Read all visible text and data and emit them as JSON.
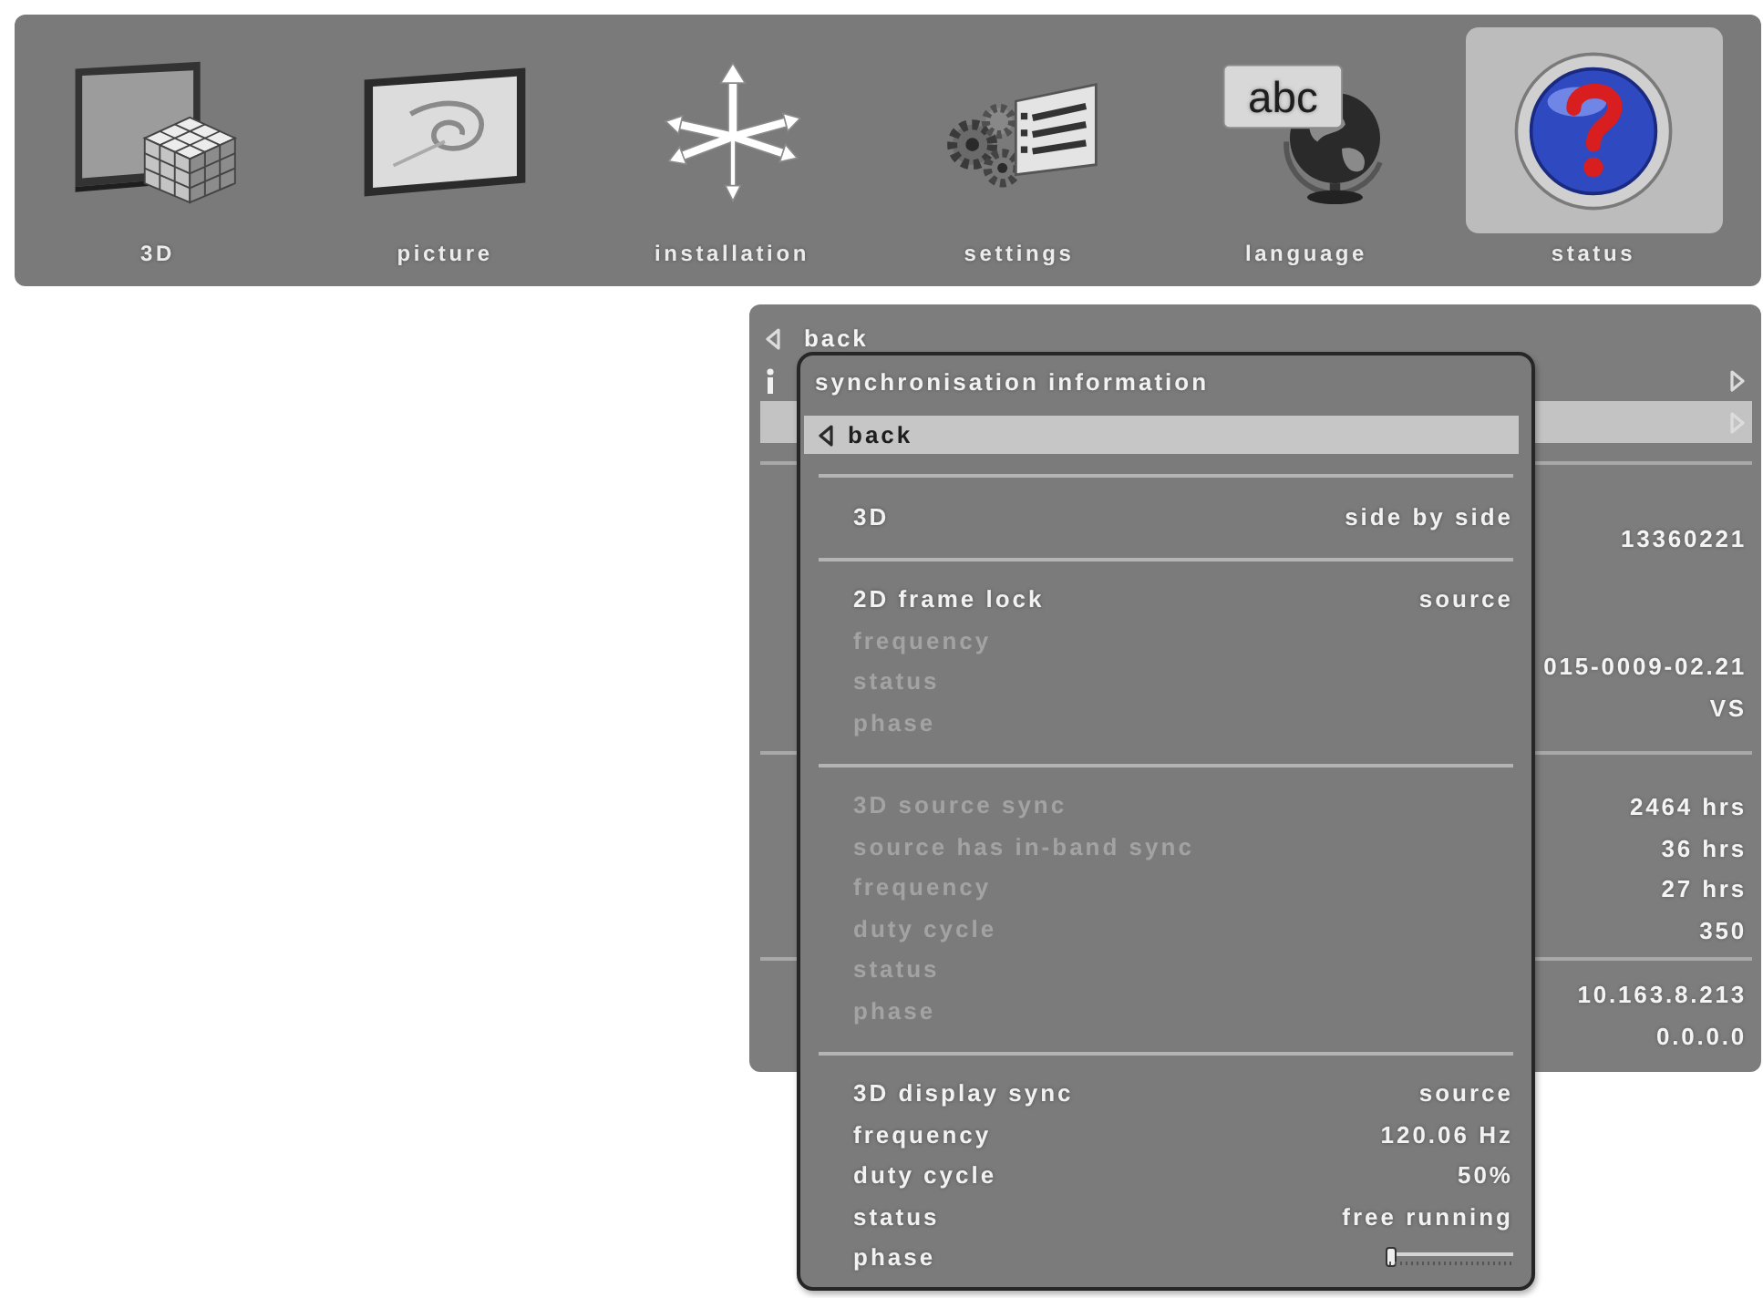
{
  "top_menu": {
    "items": [
      {
        "label": "3D",
        "selected": false
      },
      {
        "label": "picture",
        "selected": false
      },
      {
        "label": "installation",
        "selected": false
      },
      {
        "label": "settings",
        "selected": false
      },
      {
        "label": "language",
        "selected": false,
        "icon_text": "abc"
      },
      {
        "label": "status",
        "selected": true
      }
    ]
  },
  "status_menu": {
    "rows": [
      {
        "kind": "back",
        "label": "back",
        "selected": false,
        "has_submenu": false
      },
      {
        "kind": "info",
        "selected": false,
        "has_submenu": true
      },
      {
        "kind": "item",
        "selected": true,
        "has_submenu": true
      }
    ],
    "value_groups": [
      [
        "13360221",
        "015-0009-02.21",
        "VS"
      ],
      [
        "2464 hrs",
        "36 hrs",
        "27 hrs",
        "350"
      ],
      [
        "10.163.8.213",
        "0.0.0.0"
      ]
    ]
  },
  "sync_popup": {
    "title": "synchronisation information",
    "back": {
      "label": "back",
      "selected": true
    },
    "groups": [
      {
        "rows": [
          {
            "kind": "value",
            "label": "3D",
            "value": "side by side",
            "disabled": false
          }
        ]
      },
      {
        "rows": [
          {
            "kind": "value",
            "label": "2D frame lock",
            "value": "source",
            "disabled": false
          },
          {
            "kind": "value",
            "label": "frequency",
            "disabled": true
          },
          {
            "kind": "value",
            "label": "status",
            "disabled": true
          },
          {
            "kind": "value",
            "label": "phase",
            "disabled": true
          }
        ]
      },
      {
        "rows": [
          {
            "kind": "value",
            "label": "3D source sync",
            "disabled": true
          },
          {
            "kind": "value",
            "label": "source has in-band sync",
            "disabled": true
          },
          {
            "kind": "value",
            "label": "frequency",
            "disabled": true
          },
          {
            "kind": "value",
            "label": "duty cycle",
            "disabled": true
          },
          {
            "kind": "value",
            "label": "status",
            "disabled": true
          },
          {
            "kind": "value",
            "label": "phase",
            "disabled": true
          }
        ]
      },
      {
        "rows": [
          {
            "kind": "value",
            "label": "3D display sync",
            "value": "source",
            "disabled": false
          },
          {
            "kind": "value",
            "label": "frequency",
            "value": "120.06 Hz",
            "disabled": false
          },
          {
            "kind": "value",
            "label": "duty cycle",
            "value": "50%",
            "disabled": false
          },
          {
            "kind": "value",
            "label": "status",
            "value": "free running",
            "disabled": false
          },
          {
            "kind": "slider",
            "label": "phase",
            "level": 0,
            "disabled": false
          }
        ]
      }
    ]
  }
}
